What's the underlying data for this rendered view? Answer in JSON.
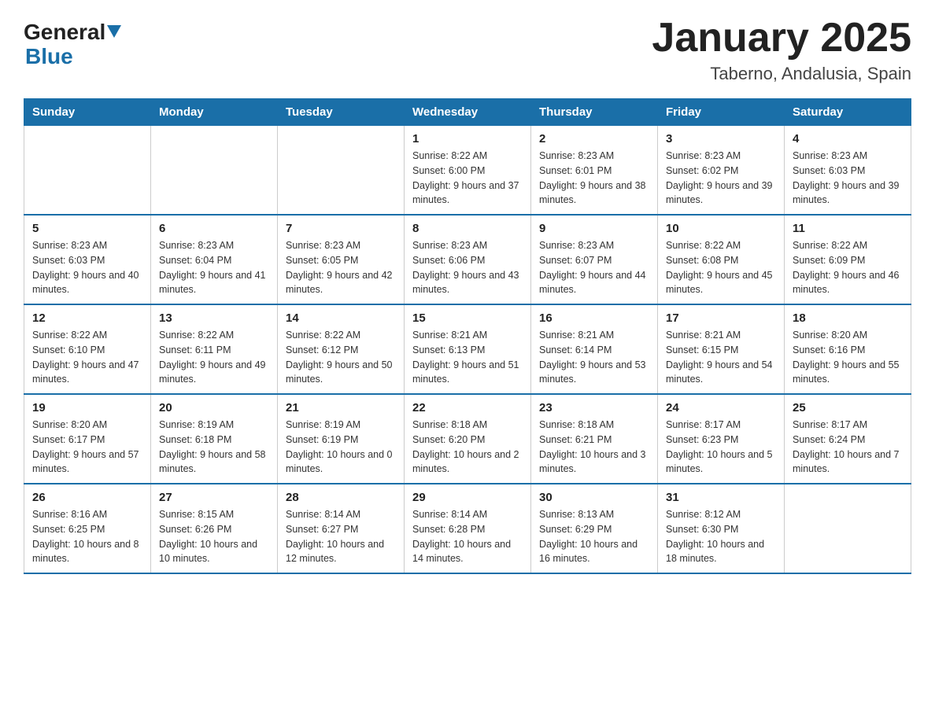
{
  "header": {
    "logo": {
      "general": "General",
      "triangle": "▶",
      "blue": "Blue"
    },
    "title": "January 2025",
    "subtitle": "Taberno, Andalusia, Spain"
  },
  "weekdays": [
    "Sunday",
    "Monday",
    "Tuesday",
    "Wednesday",
    "Thursday",
    "Friday",
    "Saturday"
  ],
  "weeks": [
    [
      {
        "day": "",
        "info": ""
      },
      {
        "day": "",
        "info": ""
      },
      {
        "day": "",
        "info": ""
      },
      {
        "day": "1",
        "info": "Sunrise: 8:22 AM\nSunset: 6:00 PM\nDaylight: 9 hours\nand 37 minutes."
      },
      {
        "day": "2",
        "info": "Sunrise: 8:23 AM\nSunset: 6:01 PM\nDaylight: 9 hours\nand 38 minutes."
      },
      {
        "day": "3",
        "info": "Sunrise: 8:23 AM\nSunset: 6:02 PM\nDaylight: 9 hours\nand 39 minutes."
      },
      {
        "day": "4",
        "info": "Sunrise: 8:23 AM\nSunset: 6:03 PM\nDaylight: 9 hours\nand 39 minutes."
      }
    ],
    [
      {
        "day": "5",
        "info": "Sunrise: 8:23 AM\nSunset: 6:03 PM\nDaylight: 9 hours\nand 40 minutes."
      },
      {
        "day": "6",
        "info": "Sunrise: 8:23 AM\nSunset: 6:04 PM\nDaylight: 9 hours\nand 41 minutes."
      },
      {
        "day": "7",
        "info": "Sunrise: 8:23 AM\nSunset: 6:05 PM\nDaylight: 9 hours\nand 42 minutes."
      },
      {
        "day": "8",
        "info": "Sunrise: 8:23 AM\nSunset: 6:06 PM\nDaylight: 9 hours\nand 43 minutes."
      },
      {
        "day": "9",
        "info": "Sunrise: 8:23 AM\nSunset: 6:07 PM\nDaylight: 9 hours\nand 44 minutes."
      },
      {
        "day": "10",
        "info": "Sunrise: 8:22 AM\nSunset: 6:08 PM\nDaylight: 9 hours\nand 45 minutes."
      },
      {
        "day": "11",
        "info": "Sunrise: 8:22 AM\nSunset: 6:09 PM\nDaylight: 9 hours\nand 46 minutes."
      }
    ],
    [
      {
        "day": "12",
        "info": "Sunrise: 8:22 AM\nSunset: 6:10 PM\nDaylight: 9 hours\nand 47 minutes."
      },
      {
        "day": "13",
        "info": "Sunrise: 8:22 AM\nSunset: 6:11 PM\nDaylight: 9 hours\nand 49 minutes."
      },
      {
        "day": "14",
        "info": "Sunrise: 8:22 AM\nSunset: 6:12 PM\nDaylight: 9 hours\nand 50 minutes."
      },
      {
        "day": "15",
        "info": "Sunrise: 8:21 AM\nSunset: 6:13 PM\nDaylight: 9 hours\nand 51 minutes."
      },
      {
        "day": "16",
        "info": "Sunrise: 8:21 AM\nSunset: 6:14 PM\nDaylight: 9 hours\nand 53 minutes."
      },
      {
        "day": "17",
        "info": "Sunrise: 8:21 AM\nSunset: 6:15 PM\nDaylight: 9 hours\nand 54 minutes."
      },
      {
        "day": "18",
        "info": "Sunrise: 8:20 AM\nSunset: 6:16 PM\nDaylight: 9 hours\nand 55 minutes."
      }
    ],
    [
      {
        "day": "19",
        "info": "Sunrise: 8:20 AM\nSunset: 6:17 PM\nDaylight: 9 hours\nand 57 minutes."
      },
      {
        "day": "20",
        "info": "Sunrise: 8:19 AM\nSunset: 6:18 PM\nDaylight: 9 hours\nand 58 minutes."
      },
      {
        "day": "21",
        "info": "Sunrise: 8:19 AM\nSunset: 6:19 PM\nDaylight: 10 hours\nand 0 minutes."
      },
      {
        "day": "22",
        "info": "Sunrise: 8:18 AM\nSunset: 6:20 PM\nDaylight: 10 hours\nand 2 minutes."
      },
      {
        "day": "23",
        "info": "Sunrise: 8:18 AM\nSunset: 6:21 PM\nDaylight: 10 hours\nand 3 minutes."
      },
      {
        "day": "24",
        "info": "Sunrise: 8:17 AM\nSunset: 6:23 PM\nDaylight: 10 hours\nand 5 minutes."
      },
      {
        "day": "25",
        "info": "Sunrise: 8:17 AM\nSunset: 6:24 PM\nDaylight: 10 hours\nand 7 minutes."
      }
    ],
    [
      {
        "day": "26",
        "info": "Sunrise: 8:16 AM\nSunset: 6:25 PM\nDaylight: 10 hours\nand 8 minutes."
      },
      {
        "day": "27",
        "info": "Sunrise: 8:15 AM\nSunset: 6:26 PM\nDaylight: 10 hours\nand 10 minutes."
      },
      {
        "day": "28",
        "info": "Sunrise: 8:14 AM\nSunset: 6:27 PM\nDaylight: 10 hours\nand 12 minutes."
      },
      {
        "day": "29",
        "info": "Sunrise: 8:14 AM\nSunset: 6:28 PM\nDaylight: 10 hours\nand 14 minutes."
      },
      {
        "day": "30",
        "info": "Sunrise: 8:13 AM\nSunset: 6:29 PM\nDaylight: 10 hours\nand 16 minutes."
      },
      {
        "day": "31",
        "info": "Sunrise: 8:12 AM\nSunset: 6:30 PM\nDaylight: 10 hours\nand 18 minutes."
      },
      {
        "day": "",
        "info": ""
      }
    ]
  ]
}
